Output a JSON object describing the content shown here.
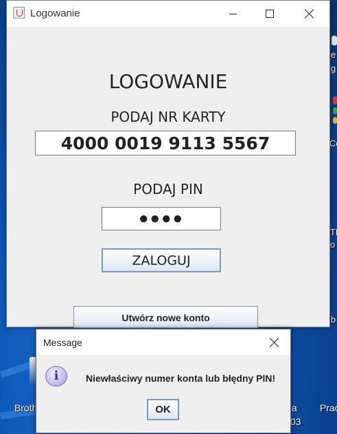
{
  "window": {
    "title": "Logowanie",
    "heading": "LOGOWANIE",
    "card_label": "PODAJ NR KARTY",
    "card_value": "4000 0019 9113 5567",
    "pin_label": "PODAJ PIN",
    "pin_value": "●●●●",
    "login_button": "ZALOGUJ",
    "create_account_button": "Utwórz nowe konto"
  },
  "dialog": {
    "title": "Message",
    "message": "Niewłaściwy numer konta lub błędny PIN!",
    "ok_button": "OK",
    "icon_glyph": "i"
  },
  "desktop": {
    "labels": [
      "Broth",
      "a",
      "03",
      "Prac"
    ],
    "fragments": [
      "e",
      "g",
      "Co",
      "TE",
      "o",
      "ib"
    ]
  },
  "colors": {
    "desktop_bg": "#0d56b5",
    "window_bg": "#efefef",
    "button_border": "#7a99c4"
  }
}
